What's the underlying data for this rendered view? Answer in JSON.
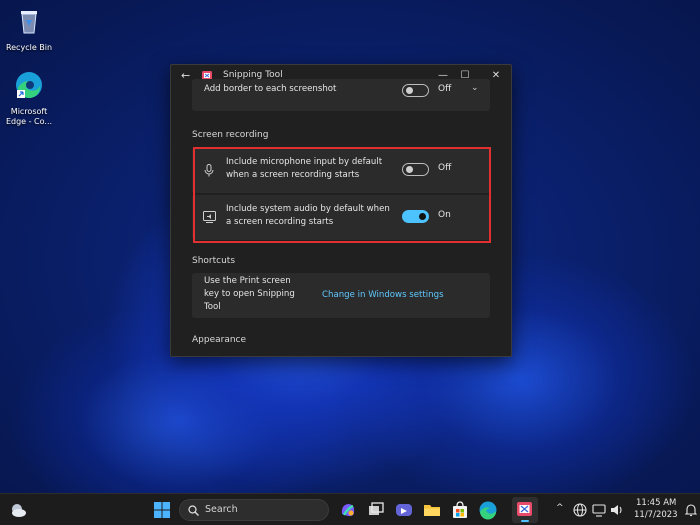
{
  "desktop": {
    "icons": [
      {
        "label_line1": "Recycle Bin",
        "label_line2": ""
      },
      {
        "label_line1": "Microsoft",
        "label_line2": "Edge - Co..."
      }
    ]
  },
  "window": {
    "title": "Snipping Tool",
    "back_glyph": "←",
    "minimize_glyph": "—",
    "maximize_glyph": "☐",
    "close_glyph": "✕",
    "top_setting": {
      "label": "Add border to each screenshot",
      "state": "Off"
    },
    "screen_recording": {
      "title": "Screen recording",
      "settings": [
        {
          "line1": "Include microphone input by default",
          "line2": "when a screen recording starts",
          "state": "Off",
          "on": false,
          "icon": "microphone-icon"
        },
        {
          "line1": "Include system audio by default when",
          "line2": "a screen recording starts",
          "state": "On",
          "on": true,
          "icon": "speaker-screen-icon"
        }
      ]
    },
    "shortcuts": {
      "title": "Shortcuts",
      "line1": "Use the Print screen",
      "line2": "key to open Snipping",
      "line3": "Tool",
      "link": "Change in Windows settings"
    },
    "appearance": {
      "title": "Appearance"
    }
  },
  "taskbar": {
    "search_placeholder": "Search",
    "time": "11:45 AM",
    "date": "11/7/2023",
    "tray_chevron": "^"
  },
  "colors": {
    "accent": "#4cc2ff",
    "link": "#60c8ff",
    "highlight": "#e03030"
  }
}
